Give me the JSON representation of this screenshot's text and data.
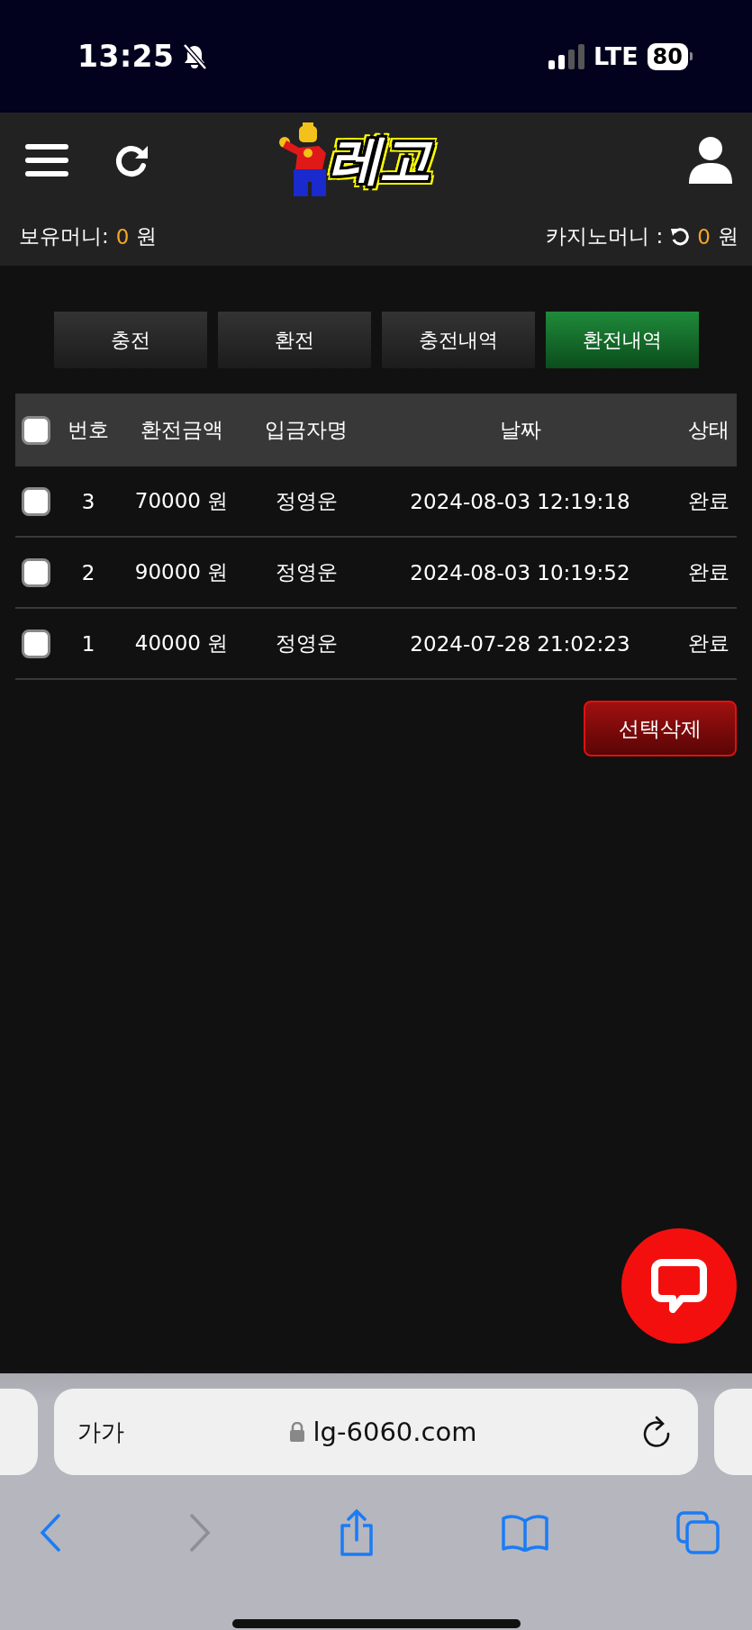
{
  "status_bar": {
    "time": "13:25",
    "network": "LTE",
    "battery": "80"
  },
  "header": {
    "logo_text": "레고",
    "balances": [
      {
        "kind": "plain",
        "label": "보유머니:",
        "amount": "0",
        "unit": "원"
      },
      {
        "kind": "refresh",
        "label": "카지노머니 :",
        "amount": "0",
        "unit": "원"
      }
    ]
  },
  "tabs": [
    {
      "label": "충전",
      "selected": false
    },
    {
      "label": "환전",
      "selected": false
    },
    {
      "label": "충전내역",
      "selected": false
    },
    {
      "label": "환전내역",
      "selected": true
    }
  ],
  "table": {
    "select_all": {
      "checked": false
    },
    "columns": [
      "번호",
      "환전금액",
      "입금자명",
      "날짜",
      "상태"
    ],
    "rows": [
      {
        "checked": false,
        "cells": [
          "3",
          "70000 원",
          "정영운",
          "2024-08-03 12:19:18",
          "완료"
        ]
      },
      {
        "checked": false,
        "cells": [
          "2",
          "90000 원",
          "정영운",
          "2024-08-03 10:19:52",
          "완료"
        ]
      },
      {
        "checked": false,
        "cells": [
          "1",
          "40000 원",
          "정영운",
          "2024-07-28 21:02:23",
          "완료"
        ]
      }
    ]
  },
  "delete_button": "선택삭제",
  "browser": {
    "text_size": "가가",
    "url": "lg-6060.com"
  }
}
